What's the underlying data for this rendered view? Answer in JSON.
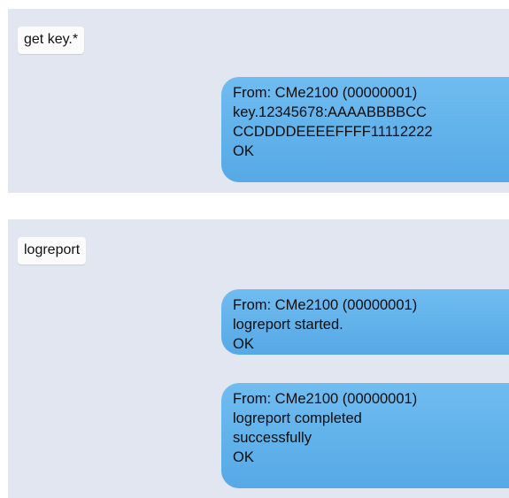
{
  "conversation": {
    "block1": {
      "sent": "get key.*",
      "reply": {
        "lines": [
          "From: CMe2100 (00000001)",
          "key.12345678:AAAABBBBCC",
          "CCDDDDEEEEFFFF11112222",
          "OK"
        ]
      }
    },
    "block2": {
      "sent": "logreport",
      "replies": [
        {
          "lines": [
            "From: CMe2100 (00000001)",
            "logreport started.",
            "OK"
          ]
        },
        {
          "lines": [
            "From: CMe2100 (00000001)",
            "logreport completed",
            "successfully",
            "OK"
          ]
        }
      ]
    }
  },
  "colors": {
    "panel_bg": "#e2e6f0",
    "sent_bubble_bg": "#fbfbfb",
    "received_bubble_top": "#6fbcf0",
    "received_bubble_bottom": "#56a9e6"
  }
}
